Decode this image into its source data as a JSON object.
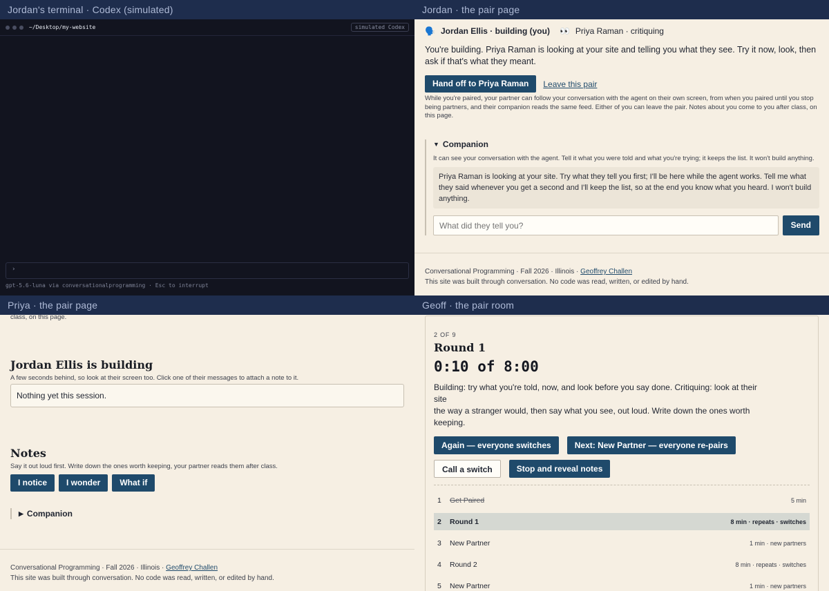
{
  "panels": {
    "terminal_title": "Jordan's terminal · Codex (simulated)",
    "jordan_title": "Jordan · the pair page",
    "priya_title": "Priya · the pair page",
    "geoff_title": "Geoff · the pair room"
  },
  "terminal": {
    "path": "~/Desktop/my-website",
    "badge": "simulated Codex",
    "prompt": "›",
    "status": "gpt-5.6-luna via conversationalprogramming  ·  Esc to interrupt"
  },
  "jordan": {
    "me_icon": "🗣️",
    "me_label": "Jordan Ellis · building (you)",
    "partner_icon": "👀",
    "partner_label": "Priya Raman · critiquing",
    "lead": "You're building. Priya Raman is looking at your site and telling you what they see. Try it now, look, then ask if that's what they meant.",
    "handoff_button": "Hand off to Priya Raman",
    "leave_link": "Leave this pair",
    "note": "While you're paired, your partner can follow your conversation with the agent on their own screen, from when you paired until you stop being partners, and their companion reads the same feed. Either of you can leave the pair. Notes about you come to you after class, on this page.",
    "companion": {
      "toggle": "▼",
      "heading": "Companion",
      "desc": "It can see your conversation with the agent. Tell it what you were told and what you're trying; it keeps the list. It won't build anything.",
      "message": "Priya Raman is looking at your site. Try what they tell you first; I'll be here while the agent works. Tell me what they said whenever you get a second and I'll keep the list, so at the end you know what you heard. I won't build anything.",
      "placeholder": "What did they tell you?",
      "send": "Send"
    }
  },
  "footer": {
    "course": "Conversational Programming",
    "term": "Fall 2026",
    "school": "Illinois",
    "author": "Geoffrey Challen",
    "sep": "·",
    "credit": "This site was built through conversation. No code was read, written, or edited by hand."
  },
  "priya": {
    "cut_text": "class, on this page.",
    "building_heading": "Jordan Ellis is building",
    "building_sub": "A few seconds behind, so look at their screen too. Click one of their messages to attach a note to it.",
    "feed_empty": "Nothing yet this session.",
    "notes_heading": "Notes",
    "notes_sub": "Say it out loud first. Write down the ones worth keeping, your partner reads them after class.",
    "notice": "I notice",
    "wonder": "I wonder",
    "what_if": "What if",
    "companion_toggle": "▶",
    "companion": "Companion"
  },
  "geoff": {
    "count": "2 OF 9",
    "round": "Round 1",
    "timer": "0:10 of 8:00",
    "desc_1": "Building: try what you're told, now, and look before you say done. Critiquing: look at their site",
    "desc_2": "the way a stranger would, then say what you see, out loud. Write down the ones worth keeping.",
    "again": "Again — everyone switches",
    "next": "Next: New Partner — everyone re-pairs",
    "call_switch": "Call a switch",
    "stop": "Stop and reveal notes",
    "schedule": [
      {
        "num": "1",
        "name": "Get Paired",
        "meta": "5 min"
      },
      {
        "num": "2",
        "name": "Round 1",
        "meta": "8 min · repeats · switches"
      },
      {
        "num": "3",
        "name": "New Partner",
        "meta": "1 min · new partners"
      },
      {
        "num": "4",
        "name": "Round 2",
        "meta": "8 min · repeats · switches"
      },
      {
        "num": "5",
        "name": "New Partner",
        "meta": "1 min · new partners"
      }
    ]
  }
}
